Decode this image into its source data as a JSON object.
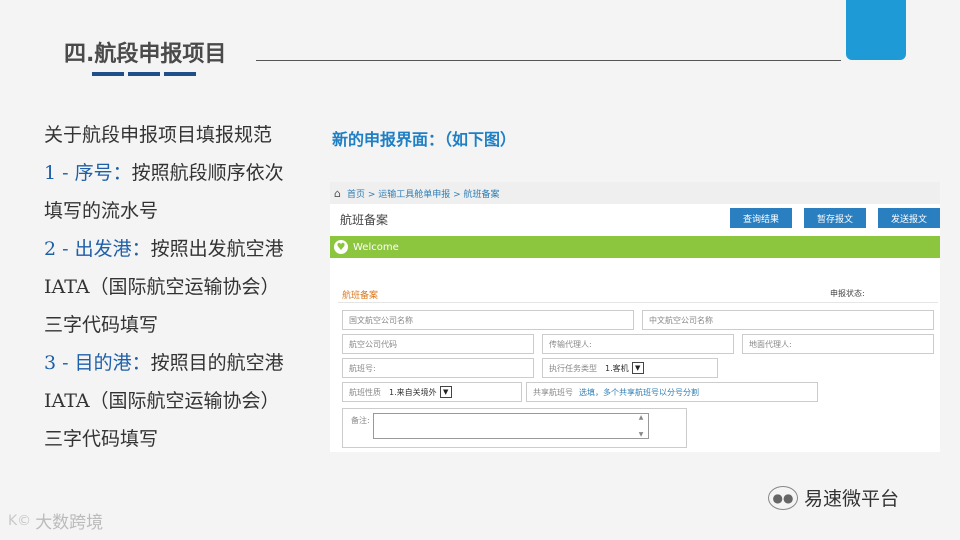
{
  "slide": {
    "title": "四.航段申报项目",
    "intro": "关于航段申报项目填报规范",
    "items": [
      {
        "label": "1 - 序号：",
        "text": "按照航段顺序依次填写的流水号"
      },
      {
        "label": "2 - 出发港：",
        "text": "按照出发航空港IATA（国际航空运输协会）三字代码填写"
      },
      {
        "label": "3 - 目的港：",
        "text": "按照目的航空港IATA（国际航空运输协会）三字代码填写"
      }
    ],
    "caption": "新的申报界面：（如下图）",
    "accent": "#1e9ad6"
  },
  "screenshot": {
    "breadcrumb": {
      "home_icon": "home-icon",
      "path": "首页 > 运输工具舱单申报 > 航班备案"
    },
    "page_title": "航班备案",
    "buttons": {
      "query": "查询结果",
      "save": "暂存报文",
      "send": "发送报文"
    },
    "welcome": "Welcome",
    "form": {
      "section_title": "航班备案",
      "status_label": "申报状态:",
      "fields": {
        "en_airline": "国文航空公司名称",
        "cn_airline": "中文航空公司名称",
        "airline_code": "航空公司代码",
        "transport_agent": "传输代理人:",
        "ground_agent": "地面代理人:",
        "flight_no": "航班号:",
        "task_type": "执行任务类型",
        "task_type_value": "1.客机",
        "flight_nature": "航班性质",
        "flight_nature_value": "1.来自关境外",
        "share_flight": "共享航班号",
        "share_flight_hint": "选填，多个共享航班号以分号分割",
        "remark": "备注:"
      }
    },
    "colors": {
      "button": "#2a7fc0",
      "welcome_bar": "#8cc63f",
      "section_title": "#d97a1f"
    }
  },
  "footer": {
    "wechat_name": "易速微平台",
    "watermark": "大数跨境",
    "watermark_logo": "K©"
  }
}
